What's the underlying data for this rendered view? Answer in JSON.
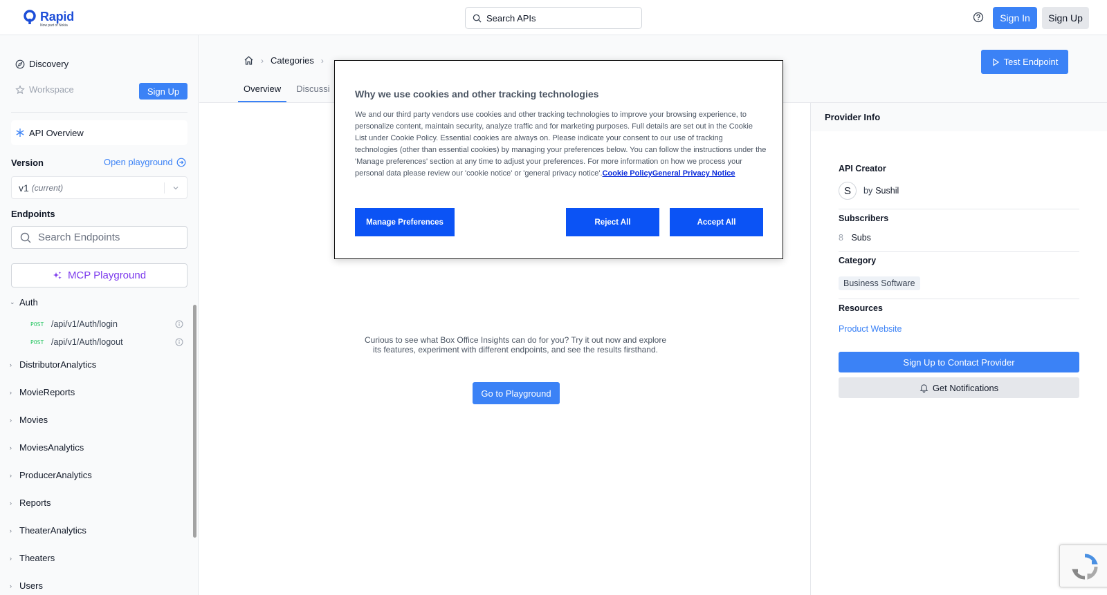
{
  "header": {
    "logo_name": "Rapid",
    "logo_sub": "Now part of Nokia",
    "search_label": "Search APIs",
    "signin_label": "Sign In",
    "signup_label": "Sign Up"
  },
  "sidebar": {
    "discovery_label": "Discovery",
    "workspace_label": "Workspace",
    "signup_label": "Sign Up",
    "api_overview_label": "API Overview",
    "version_label": "Version",
    "open_playground_label": "Open playground",
    "version_value": "v1",
    "version_suffix": "(current)",
    "endpoints_label": "Endpoints",
    "search_placeholder": "Search Endpoints",
    "mcp_label": "MCP Playground",
    "groups": [
      {
        "label": "Auth",
        "expanded": true,
        "endpoints": [
          {
            "method": "POST",
            "path": "/api/v1/Auth/login"
          },
          {
            "method": "POST",
            "path": "/api/v1/Auth/logout"
          }
        ]
      },
      {
        "label": "DistributorAnalytics"
      },
      {
        "label": "MovieReports"
      },
      {
        "label": "Movies"
      },
      {
        "label": "MoviesAnalytics"
      },
      {
        "label": "ProducerAnalytics"
      },
      {
        "label": "Reports"
      },
      {
        "label": "TheaterAnalytics"
      },
      {
        "label": "Theaters"
      },
      {
        "label": "Users"
      }
    ]
  },
  "main": {
    "breadcrumb_categories": "Categories",
    "tabs": [
      "Overview",
      "Discussi"
    ],
    "test_endpoint_label": "Test Endpoint",
    "try_text": "Curious to see what Box Office Insights can do for you? Try it out now and explore its features, experiment with different endpoints, and see the results firsthand.",
    "go_playground_label": "Go to Playground"
  },
  "provider": {
    "title": "Provider Info",
    "creator_label": "API Creator",
    "creator_initial": "S",
    "creator_by": "by",
    "creator_name": "Sushil",
    "subscribers_label": "Subscribers",
    "subscribers_count": "8",
    "subscribers_unit": "Subs",
    "category_label": "Category",
    "category_value": "Business Software",
    "resources_label": "Resources",
    "resources_link": "Product Website",
    "contact_label": "Sign Up to Contact Provider",
    "notify_label": "Get Notifications"
  },
  "cookie": {
    "title": "Why we use cookies and other tracking technologies",
    "body": "We and our third party vendors use cookies and other tracking technologies to improve your browsing experience, to personalize content, maintain security, analyze traffic and for marketing purposes. Full details are set out in the Cookie List under Cookie Policy. Essential cookies are always on. Please indicate your consent to our use of tracking technologies (other than essential cookies) by managing your preferences below. You can follow the instructions under the 'Manage preferences' section at any time to adjust your preferences. For more information on how we process your personal data please review our 'cookie notice' or 'general privacy notice'.",
    "link_cookie_policy": "Cookie Policy",
    "link_privacy": "General Privacy Notice",
    "manage_label": "Manage Preferences",
    "reject_label": "Reject All",
    "accept_label": "Accept All"
  },
  "colors": {
    "accent": "#3b82f6",
    "cookie_button": "#0b53f5",
    "mcp": "#7c3aed",
    "post_method": "#22c55e"
  }
}
